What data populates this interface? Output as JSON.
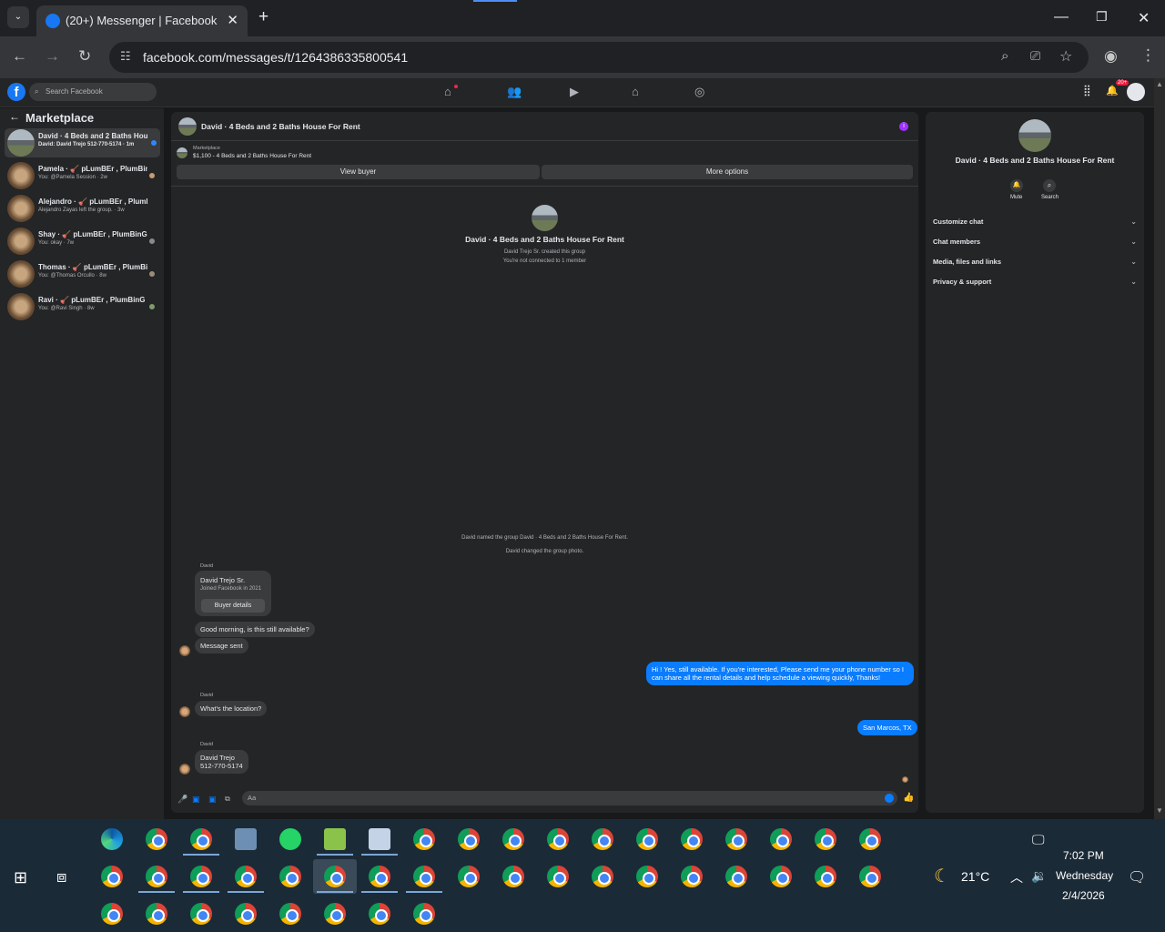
{
  "browser": {
    "tab_title": "(20+) Messenger | Facebook",
    "url": "facebook.com/messages/t/1264386335800541"
  },
  "fb": {
    "search_placeholder": "Search Facebook",
    "notif_badge": "20+"
  },
  "sidebar": {
    "title": "Marketplace",
    "conversations": [
      {
        "name": "David · 4 Beds and 2 Baths Hous...",
        "preview": "David: David Trejo 512-770-5174 · 1m"
      },
      {
        "name": "Pamela · 🪠 pLumBEr , PlumBin...",
        "preview": "You: @Pamela Session · 2w"
      },
      {
        "name": "Alejandro · 🪠 pLumBEr , PlumBin...",
        "preview": "Alejandro Zayas left the group. · 3w"
      },
      {
        "name": "Shay · 🪠 pLumBEr , PlumBinG , ...",
        "preview": "You: okay · 7w"
      },
      {
        "name": "Thomas · 🪠 pLumBEr , PlumBin...",
        "preview": "You: @Thomas Orcullo · 8w"
      },
      {
        "name": "Ravi · 🪠 pLumBEr , PlumBinG , l...",
        "preview": "You: @Ravi Singh · 8w"
      }
    ]
  },
  "chat": {
    "title": "David · 4 Beds and 2 Baths House For Rent",
    "listing_source": "Marketplace",
    "listing_title": "$1,100 - 4 Beds and 2 Baths House For Rent",
    "view_buyer": "View buyer",
    "more_options": "More options",
    "group_name": "David · 4 Beds and 2 Baths House For Rent",
    "created_by": "David Trejo Sr. created this group",
    "not_connected": "You're not connected to 1 member",
    "sys_named": "David named the group David · 4 Beds and 2 Baths House For Rent.",
    "sys_photo": "David changed the group photo.",
    "sender_david": "David",
    "card_name": "David Trejo Sr.",
    "card_joined": "Joined Facebook in 2021",
    "buyer_details": "Buyer details",
    "msg1": "Good morning, is this still available?",
    "msg2": "Message sent",
    "msg3_line1": "Hi ! Yes, still available. If you're interested, Please send me your phone number so I",
    "msg3_line2": "can share all the rental details and help schedule a viewing quickly, Thanks!",
    "msg4": "What's the location?",
    "msg5": "San Marcos, TX",
    "msg6_line1": "David Trejo",
    "msg6_line2": "512-770-5174",
    "composer_placeholder": "Aa"
  },
  "info": {
    "title": "David · 4 Beds and 2 Baths House For Rent",
    "mute": "Mute",
    "search": "Search",
    "rows": [
      "Customize chat",
      "Chat members",
      "Media, files and links",
      "Privacy & support"
    ]
  },
  "taskbar": {
    "temperature": "21°C",
    "time": "7:02 PM",
    "day": "Wednesday",
    "date": "2/4/2026"
  }
}
